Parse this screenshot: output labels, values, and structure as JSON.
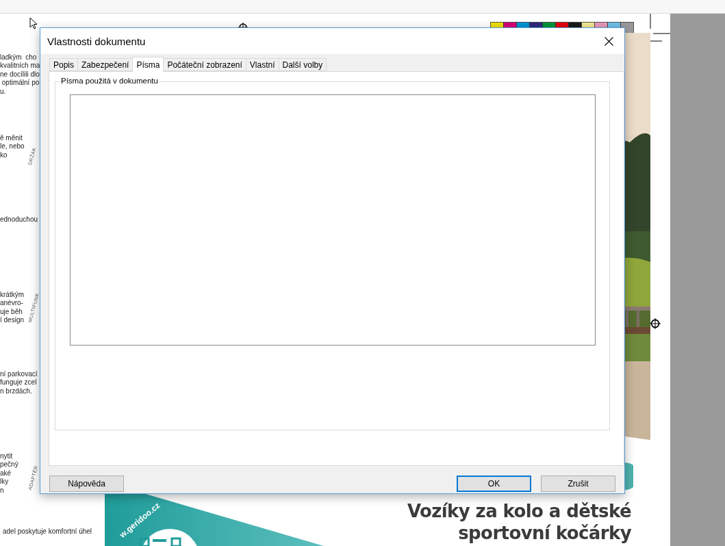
{
  "document": {
    "text_blocks": [
      {
        "lines": [
          "ladkým  cho",
          "kvalitních ma",
          "ne docílili dlo",
          " optimální po",
          "u."
        ]
      },
      {
        "lines": [
          "ě měnit",
          "le, nebo",
          "ko"
        ]
      },
      {
        "lines": [
          "ednoduchou"
        ]
      },
      {
        "lines": [
          "krátkým",
          "anévro-",
          "uje běh",
          "í design"
        ]
      },
      {
        "lines": [
          "ní parkovací",
          "funguje zcel",
          "n brzdách."
        ]
      },
      {
        "lines": [
          "nytit",
          "pečný",
          "aké",
          "lky",
          "n"
        ]
      },
      {
        "lines": [
          "adel poskytuje komfortní úhel"
        ]
      }
    ],
    "side_labels": [
      "DRŽÁK",
      "MULTIFUNK",
      "ADAPTÉR"
    ],
    "banner_url": "w.geridoo.cz",
    "headline": [
      "Vozíky za kolo a dětské",
      "sportovní kočárky"
    ]
  },
  "dialog": {
    "title": "Vlastnosti dokumentu",
    "tabs": [
      {
        "label": "Popis",
        "selected": false
      },
      {
        "label": "Zabezpečení",
        "selected": false
      },
      {
        "label": "Písma",
        "selected": true
      },
      {
        "label": "Počáteční zobrazení",
        "selected": false
      },
      {
        "label": "Vlastní",
        "selected": false
      },
      {
        "label": "Další volby",
        "selected": false
      }
    ],
    "group_label": "Písma použitá v dokumentu",
    "help_button": {
      "label": "Nápověda",
      "focused": false
    },
    "buttons": [
      {
        "label": "OK",
        "focused": true
      },
      {
        "label": "Zrušit",
        "focused": false
      }
    ]
  }
}
